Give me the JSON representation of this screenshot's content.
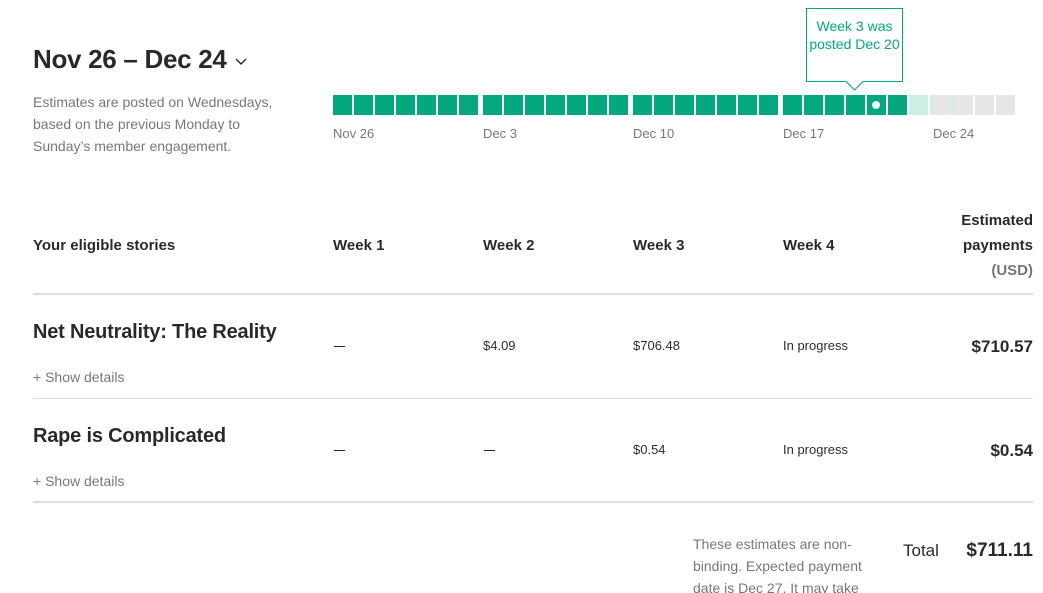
{
  "header": {
    "date_range": "Nov 26 – Dec 24",
    "intro": "Estimates are posted on Wednesdays, based on the previous Monday to Sunday’s member engagement."
  },
  "timeline": {
    "labels": [
      "Nov 26",
      "Dec 3",
      "Dec 10",
      "Dec 17",
      "Dec 24"
    ],
    "weeks": [
      [
        "done",
        "done",
        "done",
        "done",
        "done",
        "done",
        "done"
      ],
      [
        "done",
        "done",
        "done",
        "done",
        "done",
        "done",
        "done"
      ],
      [
        "done",
        "done",
        "done",
        "done",
        "done",
        "done",
        "done"
      ],
      [
        "done",
        "done",
        "done",
        "done",
        "current",
        "done",
        "partial",
        "partial",
        "partial"
      ],
      [
        "future",
        "future",
        "future",
        "future"
      ]
    ],
    "tooltip": "Week 3 was posted Dec 20"
  },
  "table": {
    "headers": {
      "stories": "Your eligible stories",
      "week1": "Week 1",
      "week2": "Week 2",
      "week3": "Week 3",
      "week4": "Week 4",
      "estimated": "Estimated payments",
      "estimated_line1": "Estimated",
      "estimated_line2": "payments",
      "estimated_unit": "(USD)"
    },
    "rows": [
      {
        "title": "Net Neutrality: The Reality",
        "week1": "",
        "week2": "$4.09",
        "week3": "$706.48",
        "week4": "In progress",
        "total": "$710.57",
        "details_label": "+ Show details"
      },
      {
        "title": "Rape is Complicated",
        "week1": "",
        "week2": "",
        "week3": "$0.54",
        "week4": "In progress",
        "total": "$0.54",
        "details_label": "+ Show details"
      }
    ]
  },
  "footer": {
    "note": "These estimates are non-binding. Expected payment date is Dec 27. It may take",
    "total_label": "Total",
    "total_value": "$711.11"
  },
  "colors": {
    "accent": "#03a87c",
    "partial": "#cdeee3",
    "future": "#e6e6e6"
  },
  "icons": {
    "range_toggle": "chevron-down-icon",
    "current_marker": "dot-icon",
    "empty_cell": "dash-icon"
  }
}
